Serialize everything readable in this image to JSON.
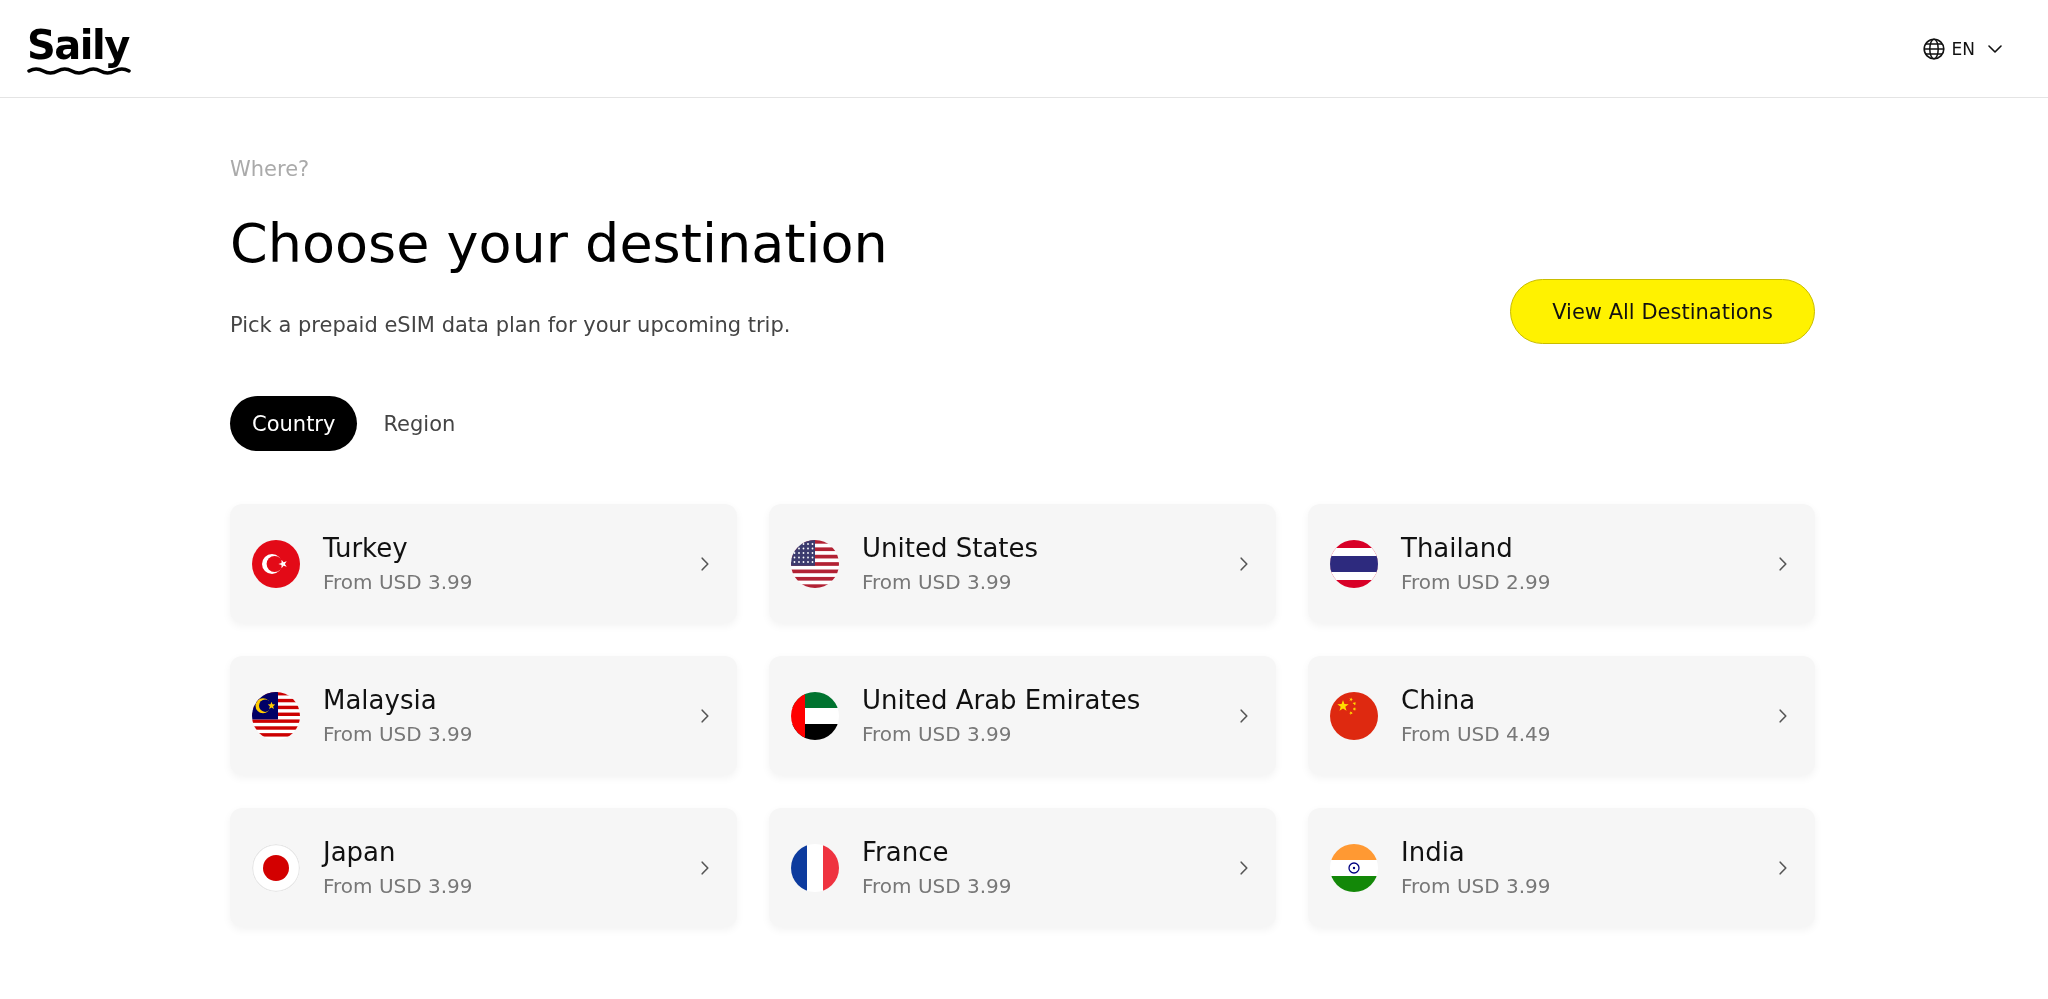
{
  "header": {
    "logo": "Saily",
    "language": "EN"
  },
  "intro": {
    "eyebrow": "Where?",
    "title": "Choose your destination",
    "subtitle": "Pick a prepaid eSIM data plan for your upcoming trip.",
    "cta": "View All Destinations"
  },
  "tabs": [
    {
      "label": "Country",
      "selected": true
    },
    {
      "label": "Region",
      "selected": false
    }
  ],
  "destinations": [
    {
      "name": "Turkey",
      "price": "From USD 3.99"
    },
    {
      "name": "United States",
      "price": "From USD 3.99"
    },
    {
      "name": "Thailand",
      "price": "From USD 2.99"
    },
    {
      "name": "Malaysia",
      "price": "From USD 3.99"
    },
    {
      "name": "United Arab Emirates",
      "price": "From USD 3.99"
    },
    {
      "name": "China",
      "price": "From USD 4.49"
    },
    {
      "name": "Japan",
      "price": "From USD 3.99"
    },
    {
      "name": "France",
      "price": "From USD 3.99"
    },
    {
      "name": "India",
      "price": "From USD 3.99"
    }
  ]
}
